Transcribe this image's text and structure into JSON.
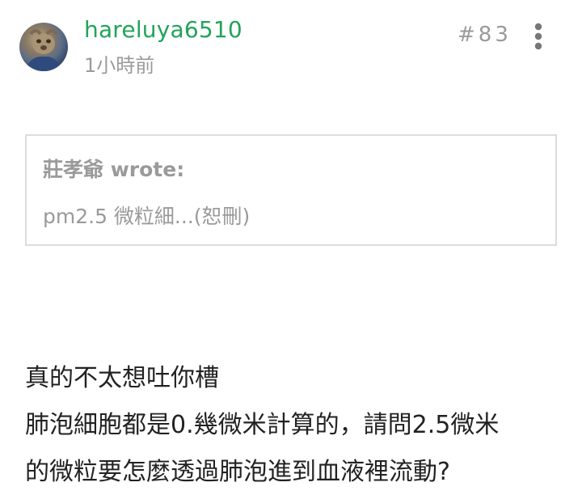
{
  "post": {
    "username": "hareluya6510",
    "time": "1小時前",
    "number": "#83",
    "quote": {
      "author": "莊孝爺 wrote:",
      "text": "pm2.5 微粒細...(恕刪)"
    },
    "body_lines": [
      "真的不太想吐你槽",
      "肺泡細胞都是0.幾微米計算的，請問2.5微米",
      "的微粒要怎麼透過肺泡進到血液裡流動?"
    ]
  },
  "icons": {
    "avatar": "user-avatar",
    "more": "more-vertical-icon"
  },
  "colors": {
    "username": "#22a35a",
    "secondary_text": "#9a9a9a",
    "body_text": "#222222",
    "quote_border": "#dcdcdc"
  }
}
